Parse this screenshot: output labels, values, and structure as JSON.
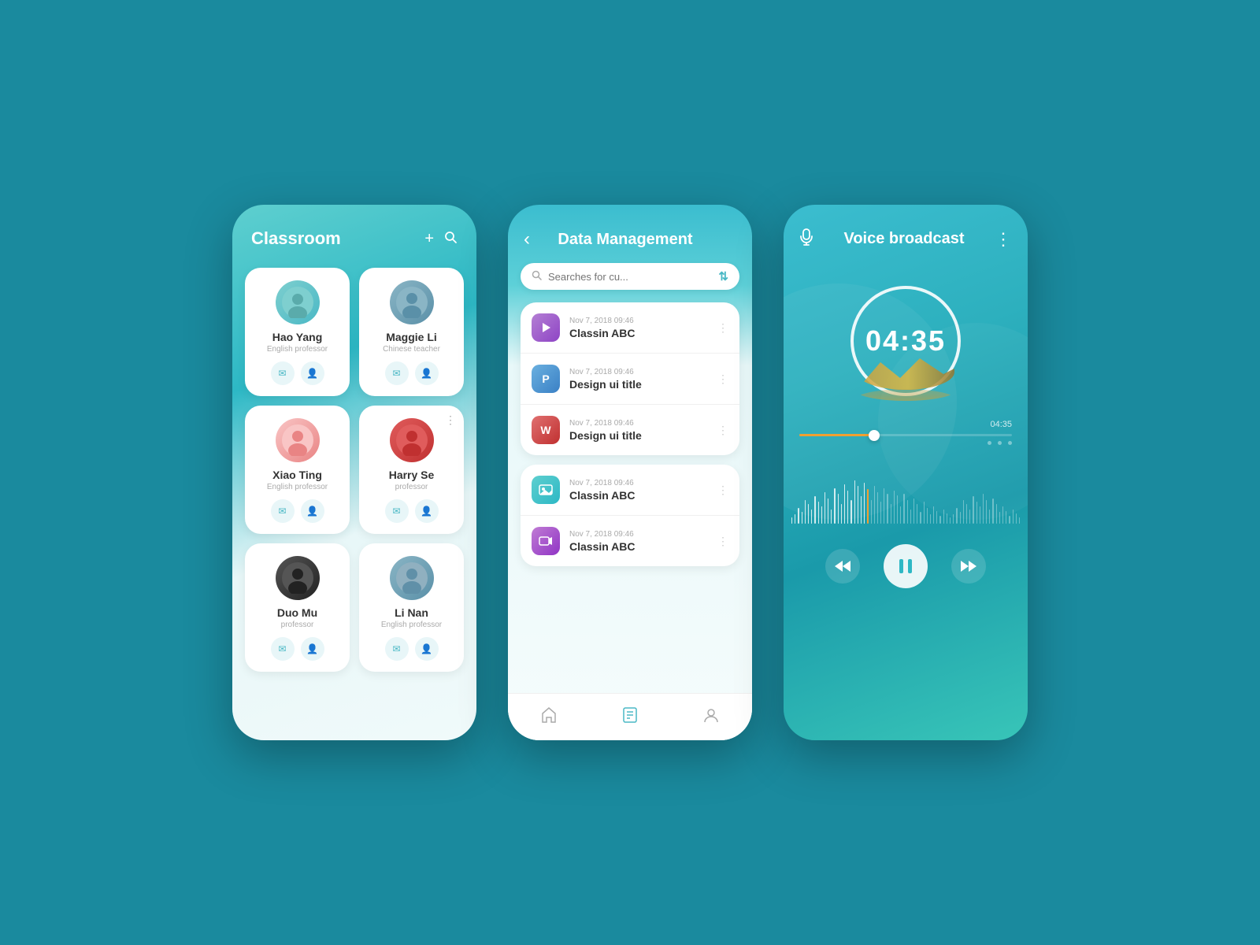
{
  "classroom": {
    "title": "Classroom",
    "add_icon": "+",
    "search_icon": "🔍",
    "persons": [
      {
        "id": "hao-yang",
        "name": "Hao Yang",
        "role": "English professor",
        "avatar_type": "teal",
        "avatar_emoji": "👤"
      },
      {
        "id": "maggie-li",
        "name": "Maggie Li",
        "role": "Chinese teacher",
        "avatar_type": "grayblue",
        "avatar_emoji": "👤"
      },
      {
        "id": "xiao-ting",
        "name": "Xiao Ting",
        "role": "English professor",
        "avatar_type": "pink",
        "avatar_emoji": "👤"
      },
      {
        "id": "harry-se",
        "name": "Harry Se",
        "role": "professor",
        "avatar_type": "red",
        "avatar_emoji": "👤",
        "has_dot_menu": true
      },
      {
        "id": "duo-mu",
        "name": "Duo Mu",
        "role": "professor",
        "avatar_type": "dark",
        "avatar_emoji": "👤"
      },
      {
        "id": "li-nan",
        "name": "Li Nan",
        "role": "English professor",
        "avatar_type": "grayblue2",
        "avatar_emoji": "👤"
      }
    ]
  },
  "data_management": {
    "title": "Data Management",
    "back_icon": "‹",
    "search_placeholder": "Searches for cu...",
    "filter_icon": "⇅",
    "groups": [
      {
        "items": [
          {
            "date": "Nov 7, 2018 09:46",
            "name": "Classin ABC",
            "icon_type": "purple",
            "icon_letter": "▶"
          },
          {
            "date": "Nov 7, 2018 09:46",
            "name": "Design ui title",
            "icon_type": "blue",
            "icon_letter": "P"
          },
          {
            "date": "Nov 7, 2018 09:46",
            "name": "Design ui title",
            "icon_type": "red",
            "icon_letter": "W"
          }
        ]
      },
      {
        "items": [
          {
            "date": "Nov 7, 2018 09:46",
            "name": "Classin ABC",
            "icon_type": "teal",
            "icon_letter": "🖼"
          },
          {
            "date": "Nov 7, 2018 09:46",
            "name": "Classin ABC",
            "icon_type": "purple2",
            "icon_letter": "🎬"
          }
        ]
      }
    ],
    "nav": [
      "🏠",
      "📖",
      "👤"
    ]
  },
  "voice_broadcast": {
    "title": "Voice broadcast",
    "mic_icon": "🎙",
    "more_icon": "⋮",
    "timer": "04:35",
    "progress_time": "04:35",
    "controls": {
      "rewind": "«",
      "pause": "⏸",
      "forward": "»"
    }
  }
}
